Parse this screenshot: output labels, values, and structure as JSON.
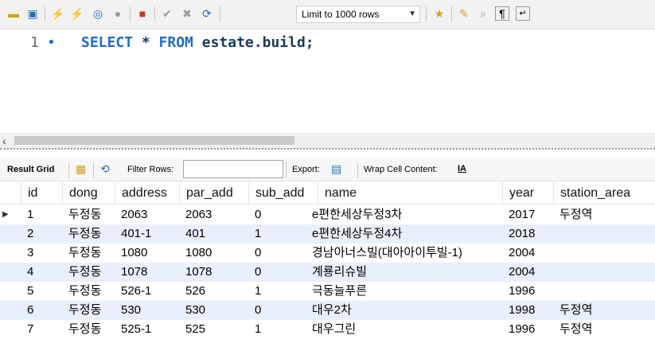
{
  "toolbar": {
    "limit_select_value": "Limit to 1000 rows",
    "icons": [
      "open-folder-icon",
      "save-icon",
      "execute-icon",
      "execute-current-icon",
      "explain-icon",
      "stop-icon",
      "toggle-error-icon",
      "commit-icon",
      "rollback-icon",
      "autocommit-icon",
      "add-snippet-icon",
      "beautify-icon",
      "find-icon",
      "invisible-chars-icon",
      "wrap-icon"
    ]
  },
  "editor": {
    "line_number": "1",
    "sql_keyword_select": "SELECT",
    "sql_star": " * ",
    "sql_keyword_from": "FROM",
    "sql_rest": " estate.build;"
  },
  "result_toolbar": {
    "result_grid_label": "Result Grid",
    "filter_rows_label": "Filter Rows:",
    "filter_rows_value": "",
    "export_label": "Export:",
    "wrap_label": "Wrap Cell Content:"
  },
  "grid": {
    "columns": [
      "id",
      "dong",
      "address",
      "par_add",
      "sub_add",
      "name",
      "year",
      "station_area"
    ],
    "rows": [
      [
        "1",
        "두정동",
        "2063",
        "2063",
        "0",
        "e편한세상두정3차",
        "2017",
        "두정역"
      ],
      [
        "2",
        "두정동",
        "401-1",
        "401",
        "1",
        "e편한세상두정4차",
        "2018",
        ""
      ],
      [
        "3",
        "두정동",
        "1080",
        "1080",
        "0",
        "경남아너스빌(대아아이투빌-1)",
        "2004",
        ""
      ],
      [
        "4",
        "두정동",
        "1078",
        "1078",
        "0",
        "계룡리슈빌",
        "2004",
        ""
      ],
      [
        "5",
        "두정동",
        "526-1",
        "526",
        "1",
        "극동늘푸른",
        "1996",
        ""
      ],
      [
        "6",
        "두정동",
        "530",
        "530",
        "0",
        "대우2차",
        "1998",
        "두정역"
      ],
      [
        "7",
        "두정동",
        "525-1",
        "525",
        "1",
        "대우그린",
        "1996",
        "두정역"
      ]
    ]
  }
}
